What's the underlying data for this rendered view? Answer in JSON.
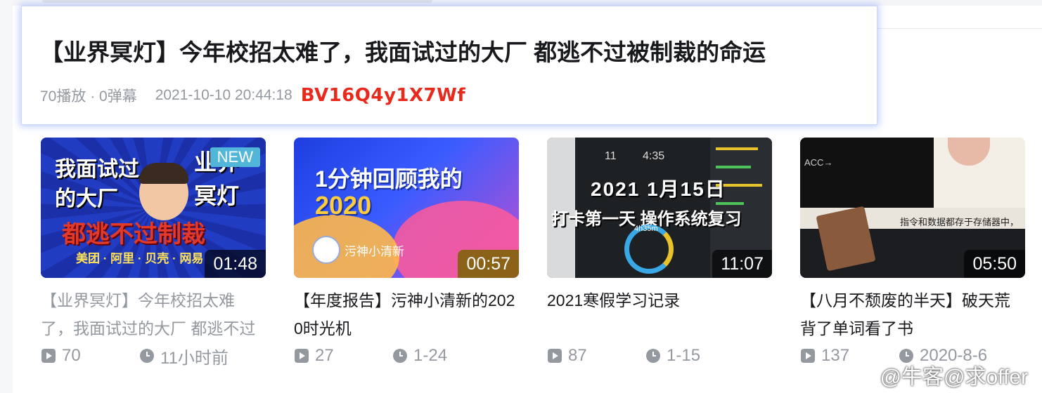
{
  "tooltip": {
    "title": "【业界冥灯】今年校招太难了，我面试过的大厂 都逃不过被制裁的命运",
    "stats": "70播放 · 0弹幕",
    "date": "2021-10-10 20:44:18",
    "bvid": "BV16Q4y1X7Wf",
    "bvid_color": "#e8291b"
  },
  "videos": [
    {
      "thumb_text": [
        "我面试过",
        "的大厂",
        "业界",
        "冥灯",
        "都逃不过制裁",
        "美团 · 阿里 · 贝壳 · 网易"
      ],
      "badge": "NEW",
      "duration": "01:48",
      "title": "【业界冥灯】今年校招太难了，我面试过的大厂 都逃不过被制裁的命运",
      "plays": "70",
      "time": "11小时前"
    },
    {
      "thumb_text": [
        "1分钟回顾我的",
        "2020",
        "污神小清新"
      ],
      "duration": "00:57",
      "title": "【年度报告】污神小清新的2020时光机",
      "plays": "27",
      "time": "1-24"
    },
    {
      "thumb_text": [
        "2021 1月15日",
        "打卡第一天 操作系统复习",
        "11",
        "4:35",
        "4h35m"
      ],
      "duration": "11:07",
      "title": "2021寒假学习记录",
      "plays": "87",
      "time": "1-15"
    },
    {
      "thumb_text": [
        "ACC→",
        "指令和数据都存于存储器中，"
      ],
      "duration": "05:50",
      "title": "【八月不颓废的半天】破天荒背了单词看了书",
      "plays": "137",
      "time": "2020-8-6"
    }
  ],
  "watermark": "@牛客@求offer"
}
